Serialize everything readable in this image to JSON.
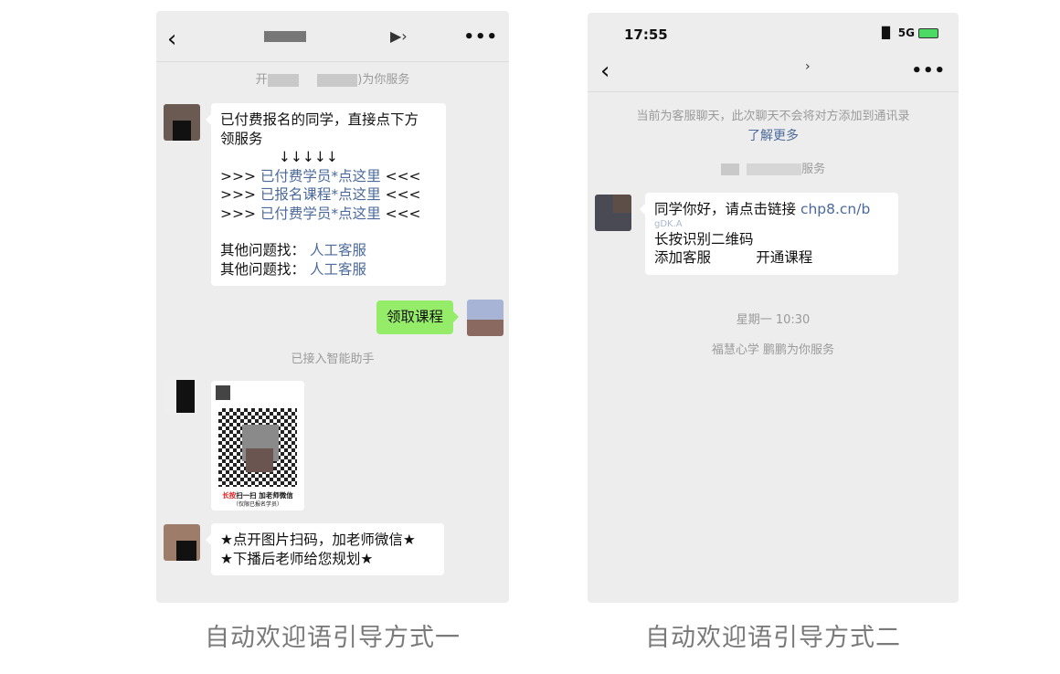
{
  "left": {
    "service_text": ")为你服务",
    "service_prefix": "开",
    "msg1": {
      "line1": "已付费报名的同学，直接点下方",
      "line2": "领服务",
      "arrows": "↓↓↓↓↓",
      "rows": [
        {
          "pre": ">>> ",
          "link": "已付费学员*点这里",
          "post": " <<<"
        },
        {
          "pre": ">>> ",
          "link": "已报名课程*点这里",
          "post": " <<<"
        },
        {
          "pre": ">>> ",
          "link": "已付费学员*点这里",
          "post": " <<<"
        }
      ],
      "other": [
        {
          "label": "其他问题找： ",
          "link": "人工客服"
        },
        {
          "label": "其他问题找： ",
          "link": "人工客服"
        }
      ]
    },
    "reply": "领取课程",
    "assistant_notice": "已接入智能助手",
    "qr_caption_red": "长按",
    "qr_caption": "扫一扫 加老师微信",
    "qr_sub": "（仅限已报名学员）",
    "msg3": {
      "line1": "★点开图片扫码，加老师微信★",
      "line2": "★下播后老师给您规划★"
    }
  },
  "right": {
    "time": "17:55",
    "signal": "5G",
    "notice": "当前为客服聊天，此次聊天不会将对方添加到通讯录",
    "learn_more": "了解更多",
    "service_text": "服务",
    "msg": {
      "text1": "同学你好，请点击链接 ",
      "link1": "chp8.cn/b",
      "link2": "gDK.A",
      "line2": "长按识别二维码",
      "line3a": "添加客服",
      "line3b": "开通课程"
    },
    "timestamp": "星期一 10:30",
    "service_line": "福慧心学 鹏鹏为你服务"
  },
  "captions": {
    "left": "自动欢迎语引导方式一",
    "right": "自动欢迎语引导方式二"
  },
  "colors": {
    "chat_bg": "#ededed",
    "link": "#4b6a9b",
    "green_bubble": "#95ec69",
    "caption": "#7a7a7a"
  },
  "icons": [
    "back-chevron-icon",
    "more-dots-icon",
    "signal-bars-icon",
    "battery-charging-icon",
    "ear-icon"
  ]
}
